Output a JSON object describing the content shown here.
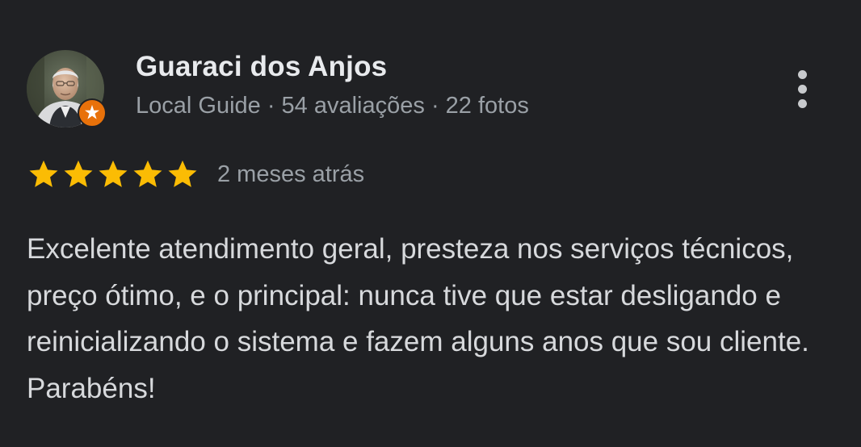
{
  "review": {
    "author_name": "Guaraci dos Anjos",
    "author_meta": "Local Guide · 54 avaliações · 22 fotos",
    "rating": 5,
    "rating_max": 5,
    "date": "2 meses atrás",
    "text": "Excelente atendimento geral, presteza nos serviços técnicos, preço ótimo, e o principal: nunca tive que estar desligando e reinicializando o sistema e fazem alguns anos que sou cliente. Parabéns!"
  },
  "icons": {
    "avatar": "user-avatar",
    "badge": "local-guide-badge-icon",
    "star": "star-icon",
    "menu": "more-vert-icon"
  },
  "colors": {
    "background": "#202124",
    "name": "#e8eaed",
    "meta": "#9aa0a6",
    "body": "#d7d9dc",
    "star": "#fbbc04",
    "badge": "#e8710a"
  }
}
